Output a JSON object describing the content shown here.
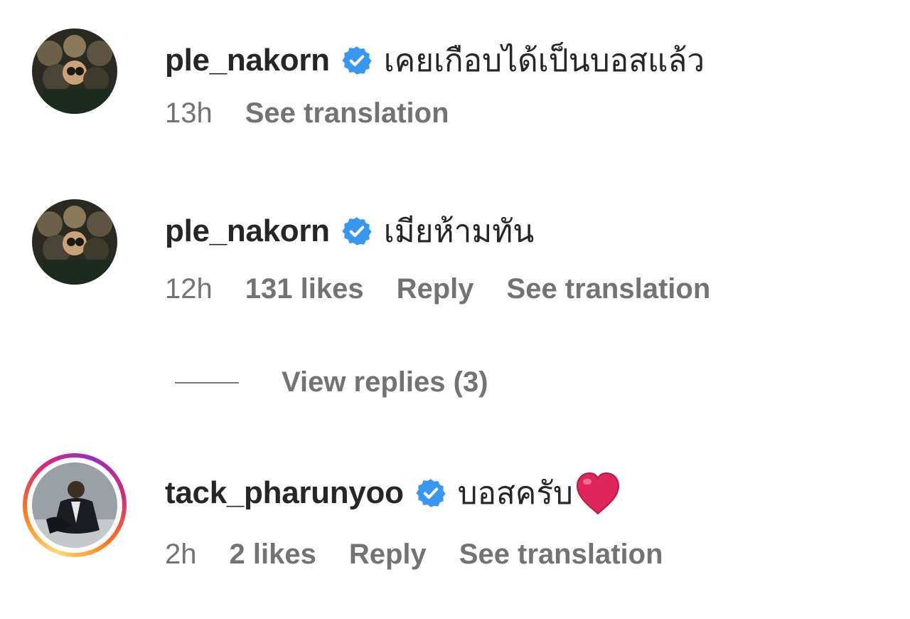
{
  "comments": [
    {
      "username": "ple_nakorn",
      "verified": true,
      "text": "เคยเกือบได้เป็นบอสแล้ว",
      "time": "13h",
      "likes": "",
      "reply_label": "",
      "translation_label": "See translation"
    },
    {
      "username": "ple_nakorn",
      "verified": true,
      "text": "เมียห้ามทัน",
      "time": "12h",
      "likes": "131 likes",
      "reply_label": "Reply",
      "translation_label": "See translation"
    },
    {
      "username": "tack_pharunyoo",
      "verified": true,
      "text": "บอสครับ",
      "time": "2h",
      "likes": "2 likes",
      "reply_label": "Reply",
      "translation_label": "See translation"
    }
  ],
  "view_replies": {
    "label": "View replies (3)"
  },
  "colors": {
    "text": "#262626",
    "secondary": "#737373",
    "verified": "#3897f0",
    "heart": "#e0245e"
  },
  "icons": {
    "verified": "verified-badge-icon",
    "heart": "red-heart-emoji"
  }
}
